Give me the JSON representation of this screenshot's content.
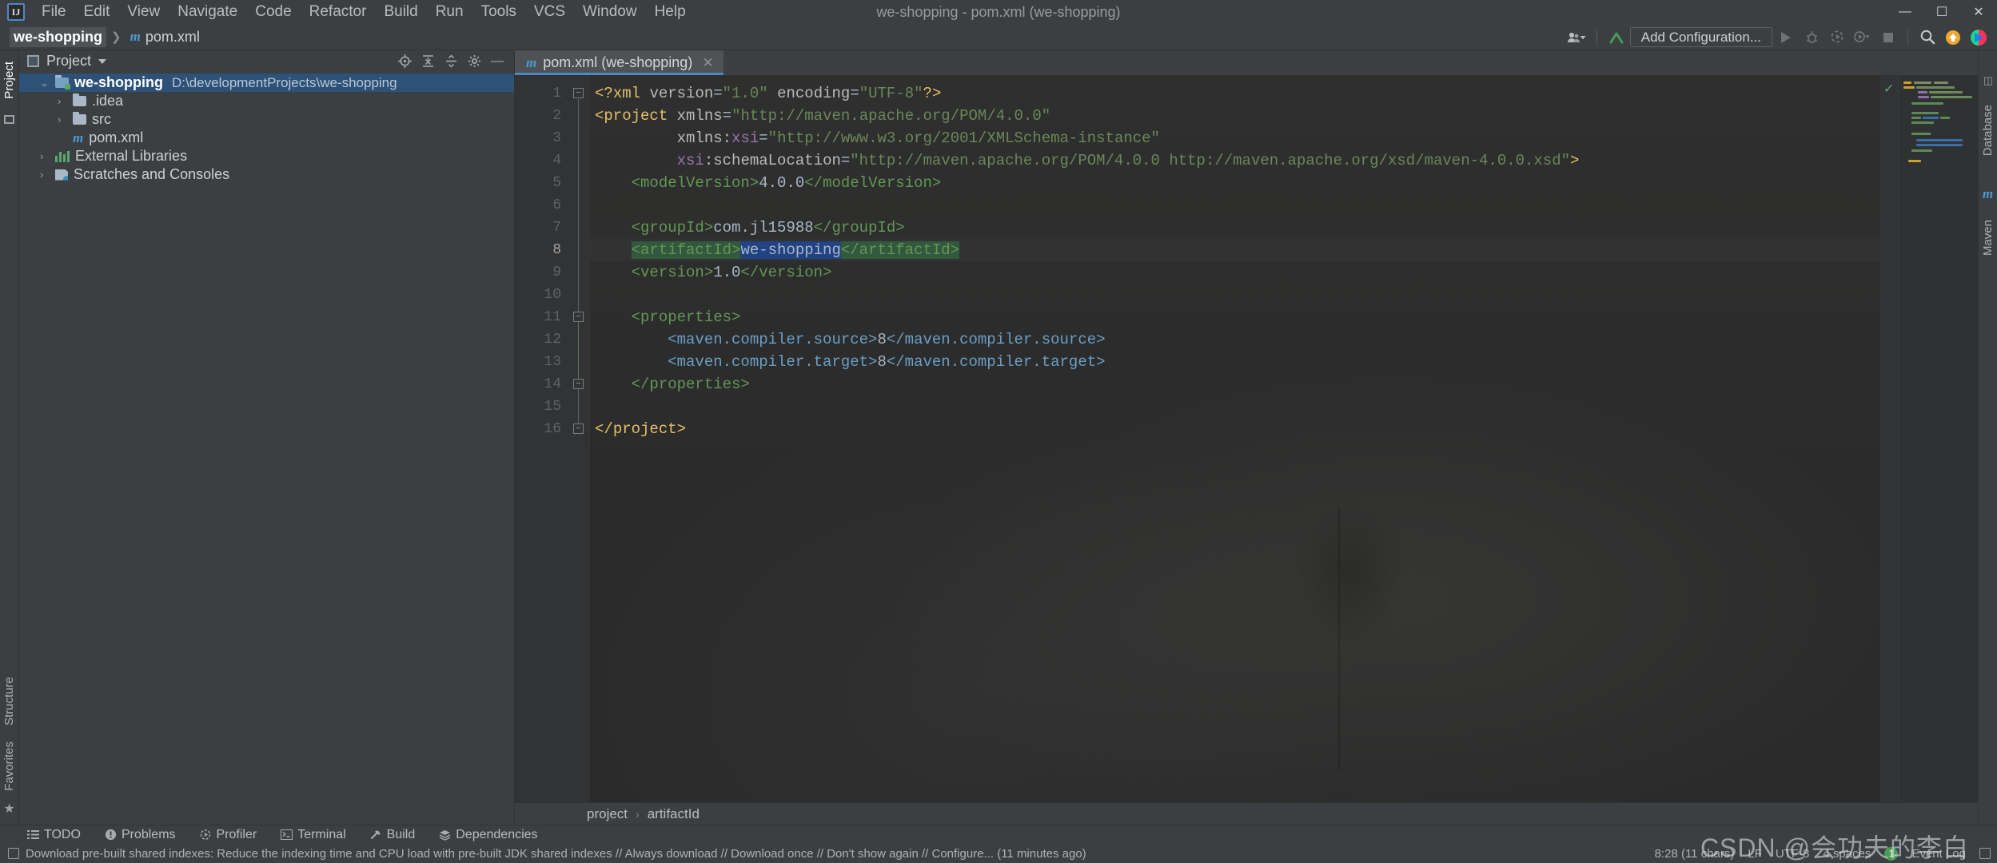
{
  "window": {
    "title": "we-shopping - pom.xml (we-shopping)",
    "logo_text": "IJ",
    "minimize": "—",
    "maximize": "☐",
    "close": "✕"
  },
  "menu": {
    "items": [
      "File",
      "Edit",
      "View",
      "Navigate",
      "Code",
      "Refactor",
      "Build",
      "Run",
      "Tools",
      "VCS",
      "Window",
      "Help"
    ]
  },
  "navbar": {
    "breadcrumbs": [
      {
        "label": "we-shopping",
        "icon": "",
        "selected": true
      },
      {
        "label": "pom.xml",
        "icon": "m",
        "selected": false
      }
    ],
    "separator": "❯",
    "add_configuration": "Add Configuration...",
    "icons": [
      "person-dropdown-icon",
      "vcs-update-icon",
      "run-icon",
      "debug-icon",
      "run-coverage-icon",
      "profile-dropdown-icon",
      "stop-icon",
      "search-everywhere-icon",
      "update-project-icon",
      "idea-logo-icon"
    ]
  },
  "left_strip": {
    "top": [
      "Project"
    ],
    "bottom": [
      "Structure",
      "Favorites"
    ]
  },
  "right_strip": {
    "items": [
      "Database",
      "Maven"
    ]
  },
  "project_panel": {
    "title": "Project",
    "actions": [
      "locate-icon",
      "expand-all-icon",
      "collapse-all-icon",
      "settings-gear-icon",
      "hide-icon"
    ],
    "tree": [
      {
        "label": "we-shopping",
        "path": "D:\\developmentProjects\\we-shopping",
        "arrow": "⌄",
        "icon": "module-folder",
        "indent": 0,
        "selected": true
      },
      {
        "label": ".idea",
        "path": "",
        "arrow": "›",
        "icon": "folder",
        "indent": 1,
        "selected": false
      },
      {
        "label": "src",
        "path": "",
        "arrow": "›",
        "icon": "folder",
        "indent": 1,
        "selected": false
      },
      {
        "label": "pom.xml",
        "path": "",
        "arrow": "",
        "icon": "maven-file",
        "indent": 1,
        "selected": false
      },
      {
        "label": "External Libraries",
        "path": "",
        "arrow": "›",
        "icon": "libraries",
        "indent": 0,
        "selected": false
      },
      {
        "label": "Scratches and Consoles",
        "path": "",
        "arrow": "›",
        "icon": "scratches",
        "indent": 0,
        "selected": false
      }
    ]
  },
  "editor": {
    "tab": {
      "label": "pom.xml (we-shopping)",
      "icon": "m",
      "close": "✕"
    },
    "line_numbers": [
      "1",
      "2",
      "3",
      "4",
      "5",
      "6",
      "7",
      "8",
      "9",
      "10",
      "11",
      "12",
      "13",
      "14",
      "15",
      "16"
    ],
    "current_line": 8,
    "breadcrumb": [
      "project",
      "artifactId"
    ],
    "breadcrumb_sep": "›",
    "lines": [
      {
        "n": 1,
        "text": "<?xml version=\"1.0\" encoding=\"UTF-8\"?>"
      },
      {
        "n": 2,
        "text": "<project xmlns=\"http://maven.apache.org/POM/4.0.0\""
      },
      {
        "n": 3,
        "text": "         xmlns:xsi=\"http://www.w3.org/2001/XMLSchema-instance\""
      },
      {
        "n": 4,
        "text": "         xsi:schemaLocation=\"http://maven.apache.org/POM/4.0.0 http://maven.apache.org/xsd/maven-4.0.0.xsd\">"
      },
      {
        "n": 5,
        "text": "    <modelVersion>4.0.0</modelVersion>"
      },
      {
        "n": 6,
        "text": ""
      },
      {
        "n": 7,
        "text": "    <groupId>com.jl15988</groupId>"
      },
      {
        "n": 8,
        "text": "    <artifactId>we-shopping</artifactId>"
      },
      {
        "n": 9,
        "text": "    <version>1.0</version>"
      },
      {
        "n": 10,
        "text": ""
      },
      {
        "n": 11,
        "text": "    <properties>"
      },
      {
        "n": 12,
        "text": "        <maven.compiler.source>8</maven.compiler.source>"
      },
      {
        "n": 13,
        "text": "        <maven.compiler.target>8</maven.compiler.target>"
      },
      {
        "n": 14,
        "text": "    </properties>"
      },
      {
        "n": 15,
        "text": ""
      },
      {
        "n": 16,
        "text": "</project>"
      }
    ],
    "selected_text": "we-shopping",
    "inspection_status": "✓"
  },
  "toolwindow_bar": {
    "items": [
      {
        "label": "TODO",
        "icon": "todo-icon"
      },
      {
        "label": "Problems",
        "icon": "problems-icon"
      },
      {
        "label": "Profiler",
        "icon": "profiler-icon"
      },
      {
        "label": "Terminal",
        "icon": "terminal-icon"
      },
      {
        "label": "Build",
        "icon": "build-hammer-icon"
      },
      {
        "label": "Dependencies",
        "icon": "dependencies-icon"
      }
    ]
  },
  "status_bar": {
    "message": "Download pre-built shared indexes: Reduce the indexing time and CPU load with pre-built JDK shared indexes // Always download // Download once // Don't show again // Configure... (11 minutes ago)",
    "caret": "8:28 (11 chars)",
    "line_separator": "LF",
    "encoding": "UTF-8",
    "indent": "4 spaces",
    "event_log": "Event Log",
    "event_count": "1",
    "watermark": "CSDN @会功夫的李白"
  },
  "colors": {
    "accent": "#4a88c7",
    "selection": "#214283",
    "occurrence": "#32593d",
    "tree_selection": "#2d5177",
    "green": "#59a869",
    "orange": "#f0a732"
  }
}
